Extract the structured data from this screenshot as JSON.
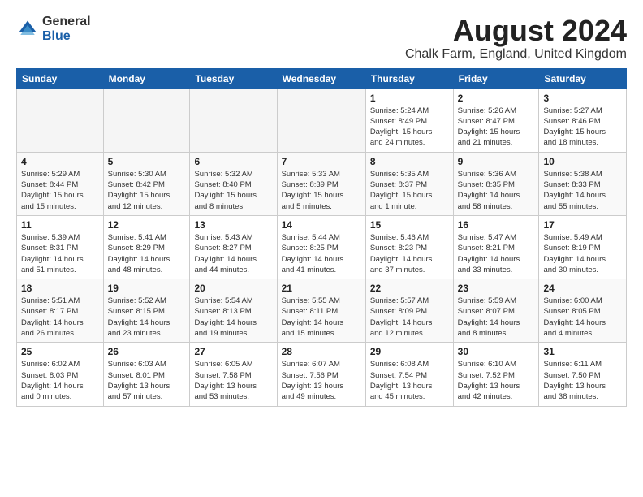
{
  "logo": {
    "general": "General",
    "blue": "Blue"
  },
  "title": "August 2024",
  "subtitle": "Chalk Farm, England, United Kingdom",
  "headers": [
    "Sunday",
    "Monday",
    "Tuesday",
    "Wednesday",
    "Thursday",
    "Friday",
    "Saturday"
  ],
  "weeks": [
    [
      {
        "day": "",
        "info": ""
      },
      {
        "day": "",
        "info": ""
      },
      {
        "day": "",
        "info": ""
      },
      {
        "day": "",
        "info": ""
      },
      {
        "day": "1",
        "info": "Sunrise: 5:24 AM\nSunset: 8:49 PM\nDaylight: 15 hours\nand 24 minutes."
      },
      {
        "day": "2",
        "info": "Sunrise: 5:26 AM\nSunset: 8:47 PM\nDaylight: 15 hours\nand 21 minutes."
      },
      {
        "day": "3",
        "info": "Sunrise: 5:27 AM\nSunset: 8:46 PM\nDaylight: 15 hours\nand 18 minutes."
      }
    ],
    [
      {
        "day": "4",
        "info": "Sunrise: 5:29 AM\nSunset: 8:44 PM\nDaylight: 15 hours\nand 15 minutes."
      },
      {
        "day": "5",
        "info": "Sunrise: 5:30 AM\nSunset: 8:42 PM\nDaylight: 15 hours\nand 12 minutes."
      },
      {
        "day": "6",
        "info": "Sunrise: 5:32 AM\nSunset: 8:40 PM\nDaylight: 15 hours\nand 8 minutes."
      },
      {
        "day": "7",
        "info": "Sunrise: 5:33 AM\nSunset: 8:39 PM\nDaylight: 15 hours\nand 5 minutes."
      },
      {
        "day": "8",
        "info": "Sunrise: 5:35 AM\nSunset: 8:37 PM\nDaylight: 15 hours\nand 1 minute."
      },
      {
        "day": "9",
        "info": "Sunrise: 5:36 AM\nSunset: 8:35 PM\nDaylight: 14 hours\nand 58 minutes."
      },
      {
        "day": "10",
        "info": "Sunrise: 5:38 AM\nSunset: 8:33 PM\nDaylight: 14 hours\nand 55 minutes."
      }
    ],
    [
      {
        "day": "11",
        "info": "Sunrise: 5:39 AM\nSunset: 8:31 PM\nDaylight: 14 hours\nand 51 minutes."
      },
      {
        "day": "12",
        "info": "Sunrise: 5:41 AM\nSunset: 8:29 PM\nDaylight: 14 hours\nand 48 minutes."
      },
      {
        "day": "13",
        "info": "Sunrise: 5:43 AM\nSunset: 8:27 PM\nDaylight: 14 hours\nand 44 minutes."
      },
      {
        "day": "14",
        "info": "Sunrise: 5:44 AM\nSunset: 8:25 PM\nDaylight: 14 hours\nand 41 minutes."
      },
      {
        "day": "15",
        "info": "Sunrise: 5:46 AM\nSunset: 8:23 PM\nDaylight: 14 hours\nand 37 minutes."
      },
      {
        "day": "16",
        "info": "Sunrise: 5:47 AM\nSunset: 8:21 PM\nDaylight: 14 hours\nand 33 minutes."
      },
      {
        "day": "17",
        "info": "Sunrise: 5:49 AM\nSunset: 8:19 PM\nDaylight: 14 hours\nand 30 minutes."
      }
    ],
    [
      {
        "day": "18",
        "info": "Sunrise: 5:51 AM\nSunset: 8:17 PM\nDaylight: 14 hours\nand 26 minutes."
      },
      {
        "day": "19",
        "info": "Sunrise: 5:52 AM\nSunset: 8:15 PM\nDaylight: 14 hours\nand 23 minutes."
      },
      {
        "day": "20",
        "info": "Sunrise: 5:54 AM\nSunset: 8:13 PM\nDaylight: 14 hours\nand 19 minutes."
      },
      {
        "day": "21",
        "info": "Sunrise: 5:55 AM\nSunset: 8:11 PM\nDaylight: 14 hours\nand 15 minutes."
      },
      {
        "day": "22",
        "info": "Sunrise: 5:57 AM\nSunset: 8:09 PM\nDaylight: 14 hours\nand 12 minutes."
      },
      {
        "day": "23",
        "info": "Sunrise: 5:59 AM\nSunset: 8:07 PM\nDaylight: 14 hours\nand 8 minutes."
      },
      {
        "day": "24",
        "info": "Sunrise: 6:00 AM\nSunset: 8:05 PM\nDaylight: 14 hours\nand 4 minutes."
      }
    ],
    [
      {
        "day": "25",
        "info": "Sunrise: 6:02 AM\nSunset: 8:03 PM\nDaylight: 14 hours\nand 0 minutes."
      },
      {
        "day": "26",
        "info": "Sunrise: 6:03 AM\nSunset: 8:01 PM\nDaylight: 13 hours\nand 57 minutes."
      },
      {
        "day": "27",
        "info": "Sunrise: 6:05 AM\nSunset: 7:58 PM\nDaylight: 13 hours\nand 53 minutes."
      },
      {
        "day": "28",
        "info": "Sunrise: 6:07 AM\nSunset: 7:56 PM\nDaylight: 13 hours\nand 49 minutes."
      },
      {
        "day": "29",
        "info": "Sunrise: 6:08 AM\nSunset: 7:54 PM\nDaylight: 13 hours\nand 45 minutes."
      },
      {
        "day": "30",
        "info": "Sunrise: 6:10 AM\nSunset: 7:52 PM\nDaylight: 13 hours\nand 42 minutes."
      },
      {
        "day": "31",
        "info": "Sunrise: 6:11 AM\nSunset: 7:50 PM\nDaylight: 13 hours\nand 38 minutes."
      }
    ]
  ]
}
